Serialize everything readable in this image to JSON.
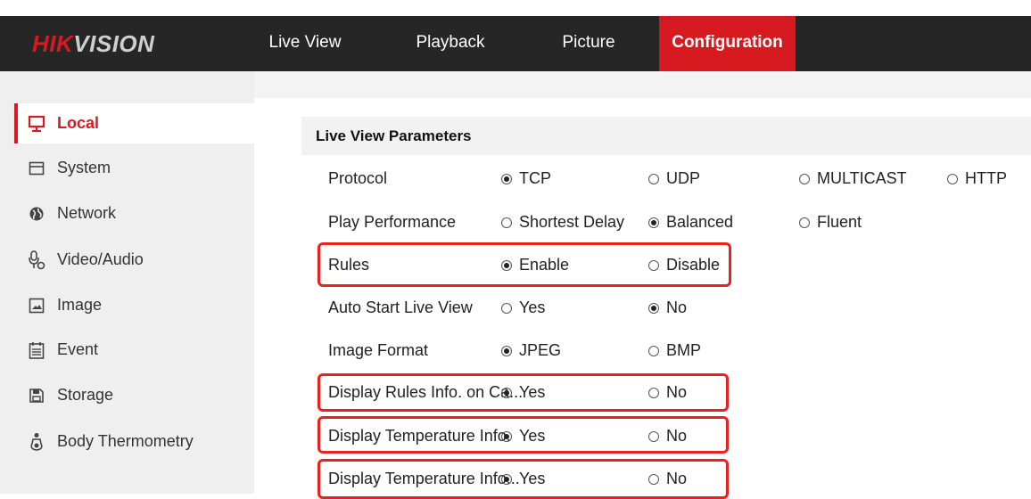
{
  "header": {
    "logo_hik": "HIK",
    "logo_vision": "VISION",
    "tabs": [
      {
        "label": "Live View",
        "active": false
      },
      {
        "label": "Playback",
        "active": false
      },
      {
        "label": "Picture",
        "active": false
      },
      {
        "label": "Configuration",
        "active": true
      }
    ]
  },
  "sidebar": {
    "items": [
      {
        "label": "Local",
        "icon": "monitor-icon",
        "active": true
      },
      {
        "label": "System",
        "icon": "system-icon",
        "active": false
      },
      {
        "label": "Network",
        "icon": "globe-icon",
        "active": false
      },
      {
        "label": "Video/Audio",
        "icon": "microphone-icon",
        "active": false
      },
      {
        "label": "Image",
        "icon": "image-icon",
        "active": false
      },
      {
        "label": "Event",
        "icon": "calendar-icon",
        "active": false
      },
      {
        "label": "Storage",
        "icon": "disk-icon",
        "active": false
      },
      {
        "label": "Body Thermometry",
        "icon": "thermometer-icon",
        "active": false
      }
    ]
  },
  "section": {
    "title": "Live View Parameters"
  },
  "rows": [
    {
      "label": "Protocol",
      "options": [
        {
          "label": "TCP",
          "selected": true
        },
        {
          "label": "UDP",
          "selected": false
        },
        {
          "label": "MULTICAST",
          "selected": false
        },
        {
          "label": "HTTP",
          "selected": false
        }
      ]
    },
    {
      "label": "Play Performance",
      "options": [
        {
          "label": "Shortest Delay",
          "selected": false
        },
        {
          "label": "Balanced",
          "selected": true
        },
        {
          "label": "Fluent",
          "selected": false
        }
      ]
    },
    {
      "label": "Rules",
      "options": [
        {
          "label": "Enable",
          "selected": true
        },
        {
          "label": "Disable",
          "selected": false
        }
      ]
    },
    {
      "label": "Auto Start Live View",
      "options": [
        {
          "label": "Yes",
          "selected": false
        },
        {
          "label": "No",
          "selected": true
        }
      ]
    },
    {
      "label": "Image Format",
      "options": [
        {
          "label": "JPEG",
          "selected": true
        },
        {
          "label": "BMP",
          "selected": false
        }
      ]
    },
    {
      "label": "Display Rules Info. on Ca...",
      "options": [
        {
          "label": "Yes",
          "selected": true
        },
        {
          "label": "No",
          "selected": false
        }
      ]
    },
    {
      "label": "Display Temperature Info.",
      "options": [
        {
          "label": "Yes",
          "selected": true
        },
        {
          "label": "No",
          "selected": false
        }
      ]
    },
    {
      "label": "Display Temperature Info...",
      "options": [
        {
          "label": "Yes",
          "selected": true
        },
        {
          "label": "No",
          "selected": false
        }
      ]
    }
  ],
  "colors": {
    "accent": "#d71920",
    "highlight": "#e8231f",
    "header_bg": "#262626",
    "sidebar_bg": "#efefef"
  }
}
